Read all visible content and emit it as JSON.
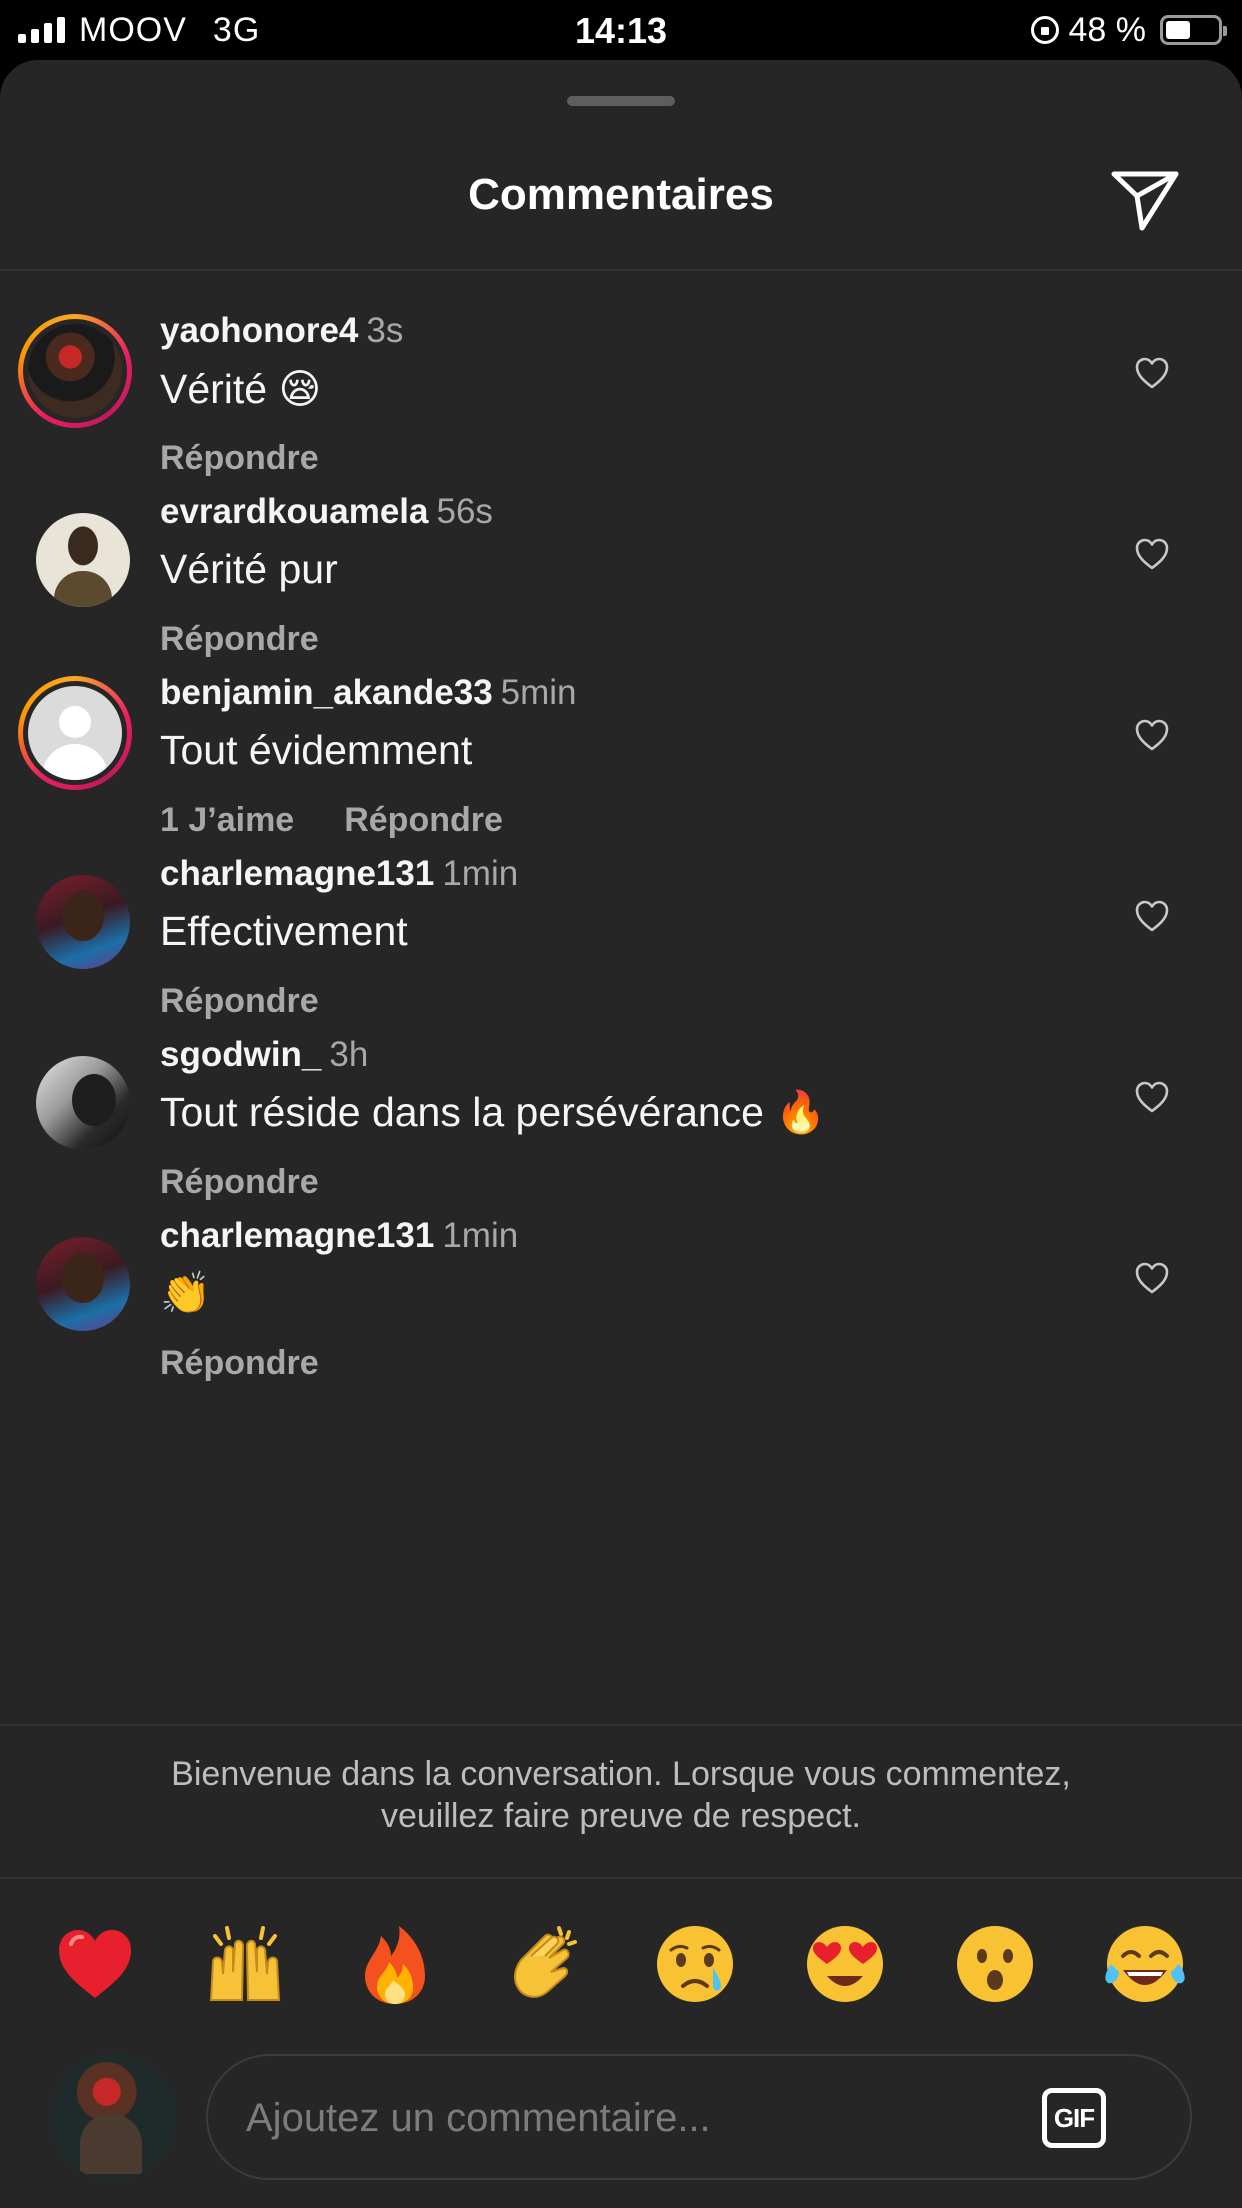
{
  "status_bar": {
    "carrier": "MOOV",
    "network": "3G",
    "time": "14:13",
    "battery_pct": "48 %",
    "battery_level": 0.48,
    "signal_bars": 4
  },
  "sheet": {
    "title": "Commentaires",
    "send_icon": "paper-plane-icon"
  },
  "comments": [
    {
      "username": "yaohonore4",
      "time": "3s",
      "text": "Vérité 😪",
      "reply": "Répondre",
      "likes": "",
      "story_ring": true
    },
    {
      "username": "evrardkouamela",
      "time": "56s",
      "text": "Vérité pur",
      "reply": "Répondre",
      "likes": "",
      "story_ring": false
    },
    {
      "username": "benjamin_akande33",
      "time": "5min",
      "text": "Tout évidemment",
      "reply": "Répondre",
      "likes": "1 J’aime",
      "story_ring": true
    },
    {
      "username": "charlemagne131",
      "time": "1min",
      "text": "Effectivement",
      "reply": "Répondre",
      "likes": "",
      "story_ring": false
    },
    {
      "username": "sgodwin_",
      "time": "3h",
      "text": "Tout réside dans la persévérance 🔥",
      "reply": "Répondre",
      "likes": "",
      "story_ring": false
    },
    {
      "username": "charlemagne131",
      "time": "1min",
      "text": "👏",
      "reply": "Répondre",
      "likes": "",
      "story_ring": false
    }
  ],
  "welcome_message": "Bienvenue dans la conversation. Lorsque vous commentez, veuillez faire preuve de respect.",
  "reactions": [
    "❤️",
    "🙌",
    "🔥",
    "👏",
    "😢",
    "😍",
    "😮",
    "😂"
  ],
  "composer": {
    "placeholder": "Ajoutez un commentaire...",
    "gif_label": "GIF"
  },
  "colors": {
    "sheet_bg": "#262626",
    "secondary_text": "#a8a8a8",
    "story_ring": "#e91e63"
  }
}
